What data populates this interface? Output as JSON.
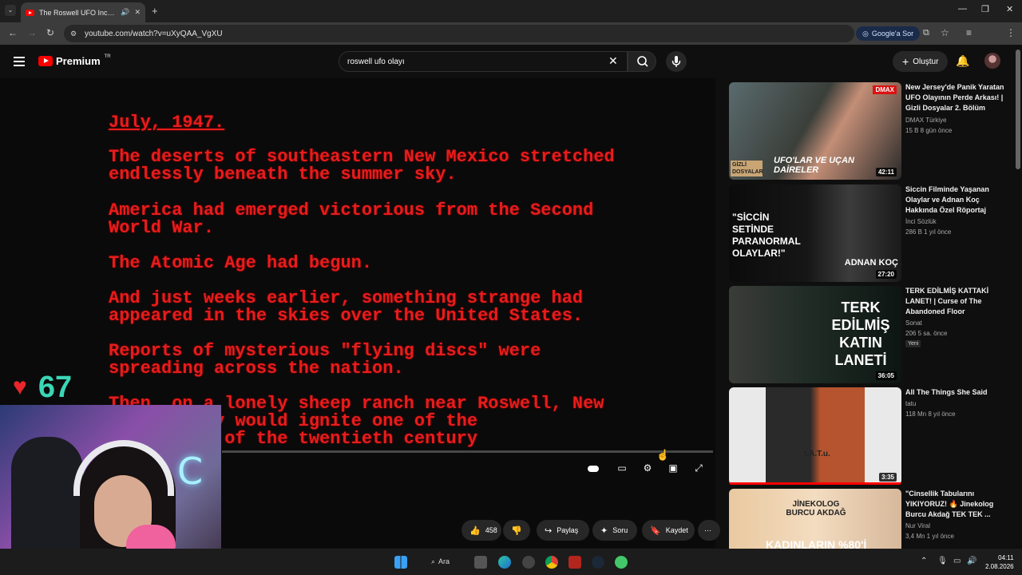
{
  "browser": {
    "tab_title": "The Roswell UFO Incident (/",
    "url": "youtube.com/watch?v=uXyQAA_VgXU",
    "google_pill": "Google'a Sor"
  },
  "header": {
    "logo": "Premium",
    "logo_region": "TR",
    "search_value": "roswell ufo olayı",
    "create_label": "Oluştur"
  },
  "video": {
    "lines": [
      "July, 1947.",
      "The deserts of southeastern New Mexico stretched\nendlessly beneath the summer sky.",
      "America had emerged victorious from the Second\nWorld War.",
      "The Atomic Age had begun.",
      "And just weeks earlier, something strange had\nappeared in the skies over the United States.",
      "Reports of mysterious \"flying discs\" were\nspreading across the nation.",
      "Then, on a lonely sheep ranch near Roswell, New\n  discovery would ignite one of the\n  ysteries of the twentieth century"
    ]
  },
  "overlay": {
    "heart": "♥",
    "count": "67"
  },
  "actions": {
    "like_count": "458",
    "share": "Paylaş",
    "ask": "Soru",
    "save": "Kaydet"
  },
  "recommendations": [
    {
      "title": "New Jersey'de Panik Yaratan UFO Olayının Perde Arkası! | Gizli Dosyalar 2. Bölüm",
      "channel": "DMAX Türkiye",
      "meta": "15 B  8 gün önce",
      "duration": "42:11",
      "thumb_text": "UFO'LAR VE UÇAN DAİRELER",
      "thumb_badge": "DMAX",
      "thumb_tag": "GİZLİ DOSYALAR"
    },
    {
      "title": "Siccin Filminde Yaşanan Olaylar ve Adnan Koç Hakkında Özel Röportaj",
      "channel": "İnci Sözlük",
      "meta": "286 B  1 yıl önce",
      "duration": "27:20",
      "thumb_text": "\"SİCCİN SETİNDE PARANORMAL OLAYLAR!\"",
      "thumb_name": "ADNAN KOÇ"
    },
    {
      "title": "TERK EDİLMİŞ KATTAKİ LANET! | Curse of The Abandoned Floor",
      "channel": "Sonat",
      "meta": "206  5 sa. önce",
      "duration": "36:05",
      "badge": "Yeni",
      "thumb_text": "TERK EDİLMİŞ KATIN LANETİ"
    },
    {
      "title": "All The Things She Said",
      "channel": "tatu",
      "meta": "118 Mn  8 yıl önce",
      "duration": "3:35",
      "thumb_text": "t.A.T.u."
    },
    {
      "title": "\"Cinsellik Tabularını YIKIYORUZ! 🔥 Jinekolog Burcu Akdağ TEK TEK ...",
      "channel": "Nur Viral",
      "meta": "3,4 Mn  1 yıl önce",
      "thumb_text": "JİNEKOLOG BURCU AKDAĞ",
      "thumb_bottom": "KADINLARIN %80'İ"
    }
  ],
  "taskbar": {
    "search": "Ara",
    "time": "04:11",
    "date": "2.08.2026"
  }
}
